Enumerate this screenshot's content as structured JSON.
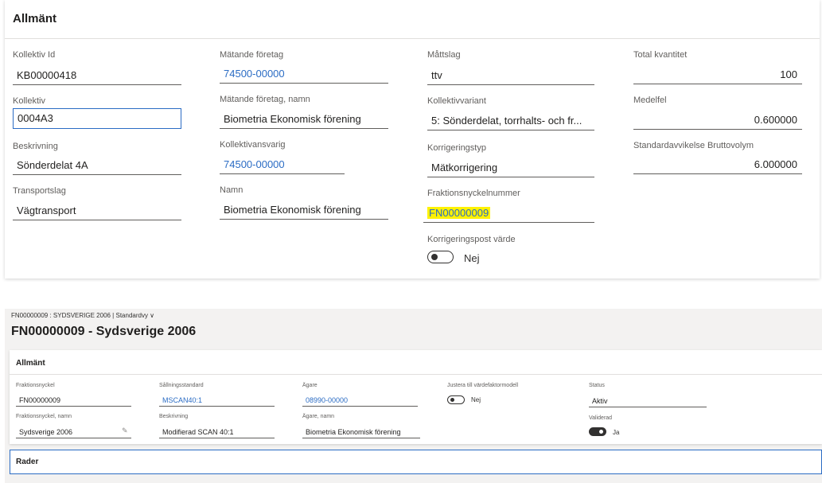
{
  "general": {
    "title": "Allmänt",
    "collective_id": {
      "label": "Kollektiv Id",
      "value": "KB00000418"
    },
    "collective": {
      "label": "Kollektiv",
      "value": "0004A3"
    },
    "description": {
      "label": "Beskrivning",
      "value": "Sönderdelat 4A"
    },
    "transport": {
      "label": "Transportslag",
      "value": "Vägtransport"
    },
    "measuring_company": {
      "label": "Mätande företag",
      "value": "74500-00000"
    },
    "measuring_company_name": {
      "label": "Mätande företag, namn",
      "value": "Biometria Ekonomisk förening"
    },
    "collective_responsible": {
      "label": "Kollektivansvarig",
      "value": "74500-00000"
    },
    "name": {
      "label": "Namn",
      "value": "Biometria Ekonomisk förening"
    },
    "measure_type": {
      "label": "Måttslag",
      "value": "ttv"
    },
    "collective_variant": {
      "label": "Kollektivvariant",
      "value": "5: Sönderdelat, torrhalts- och fr..."
    },
    "correction_type": {
      "label": "Korrigeringstyp",
      "value": "Mätkorrigering"
    },
    "fraction_key_number": {
      "label": "Fraktionsnyckelnummer",
      "value": "FN00000009"
    },
    "correction_post_value": {
      "label": "Korrigeringspost värde",
      "toggle": false,
      "text": "Nej"
    },
    "total_quantity": {
      "label": "Total kvantitet",
      "value": "100"
    },
    "mean_error": {
      "label": "Medelfel",
      "value": "0.600000"
    },
    "std_dev": {
      "label": "Standardavvikelse Bruttovolym",
      "value": "6.000000"
    }
  },
  "fraction_page": {
    "breadcrumb": "FN00000009 : SYDSVERIGE 2006  |  Standardvy ∨",
    "title": "FN00000009 - Sydsverige 2006",
    "section_title": "Allmänt",
    "fraction_key": {
      "label": "Fraktionsnyckel",
      "value": "FN00000009"
    },
    "fraction_key_name": {
      "label": "Fraktionsnyckel, namn",
      "value": "Sydsverige 2006"
    },
    "sorting_standard": {
      "label": "Sållningsstandard",
      "value": "MSCAN40:1"
    },
    "description": {
      "label": "Beskrivning",
      "value": "Modifierad SCAN 40:1"
    },
    "owner": {
      "label": "Ägare",
      "value": "08990-00000"
    },
    "owner_name": {
      "label": "Ägare, namn",
      "value": "Biometria Ekonomisk förening"
    },
    "adjust_value_model": {
      "label": "Justera till värdefaktormodell",
      "toggle": false,
      "text": "Nej"
    },
    "status": {
      "label": "Status",
      "value": "Aktiv"
    },
    "validated": {
      "label": "Validerad",
      "toggle": true,
      "text": "Ja"
    },
    "rows_section_title": "Rader"
  },
  "colors": {
    "accent": "#2b6cc4",
    "highlight": "#fff200"
  }
}
